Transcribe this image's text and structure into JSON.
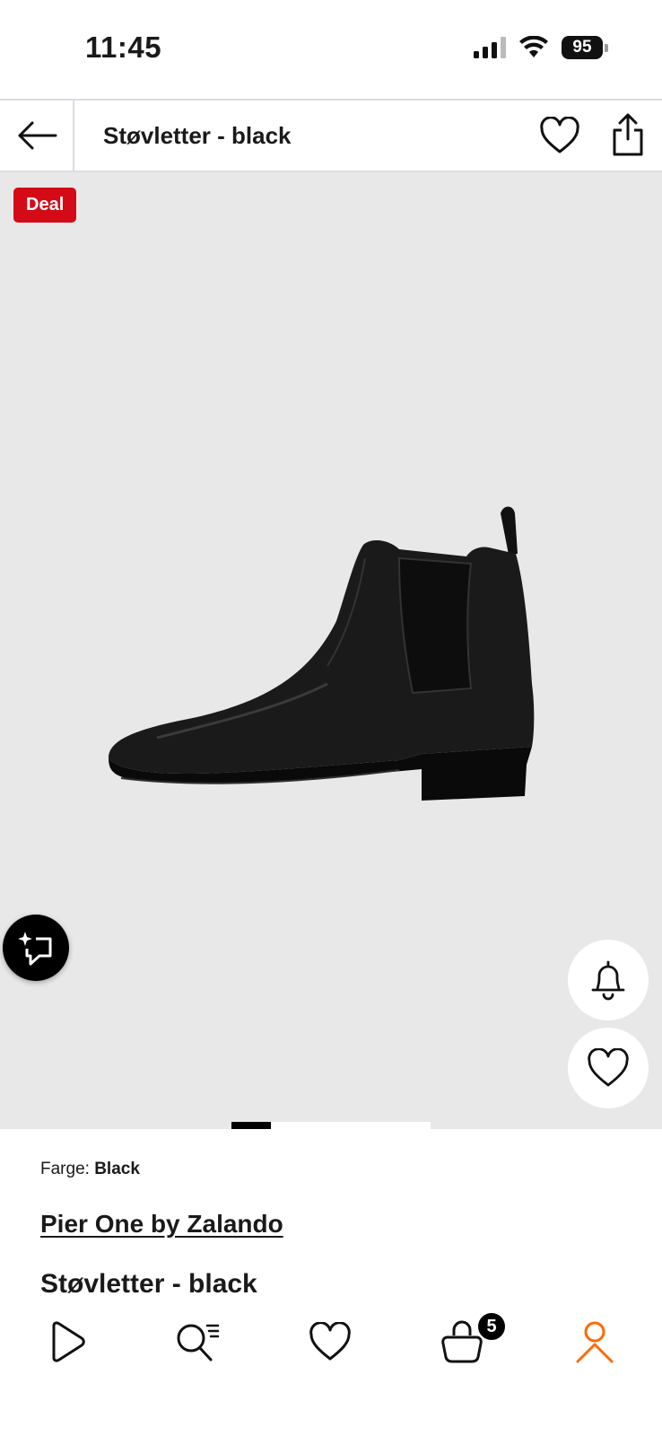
{
  "status_bar": {
    "time": "11:45",
    "battery": "95"
  },
  "header": {
    "title": "Støvletter - black"
  },
  "gallery": {
    "deal_label": "Deal",
    "image_progress": 0.2
  },
  "product": {
    "color_label": "Farge:",
    "color_value": "Black",
    "brand": "Pier One by Zalando",
    "name": "Støvletter - black"
  },
  "bottom_nav": {
    "items": [
      "play-icon",
      "search-icon",
      "heart-icon",
      "bag-icon",
      "profile-icon"
    ],
    "cart_count": "5",
    "active_color": "#ff6900"
  },
  "colors": {
    "deal": "#d40a17",
    "gallery_bg": "#e8e8e8"
  }
}
